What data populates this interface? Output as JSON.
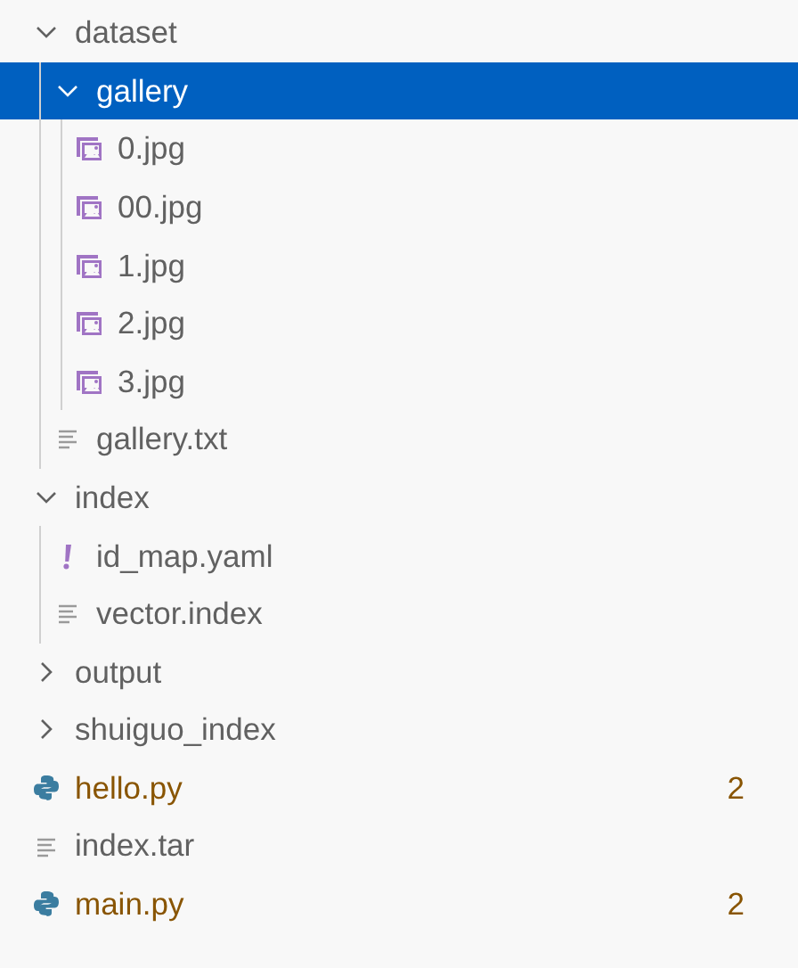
{
  "explorer": {
    "items": [
      {
        "name": "dataset",
        "kind": "folder",
        "expanded": true,
        "selected": false,
        "warning": false,
        "children": [
          {
            "name": "gallery",
            "kind": "folder",
            "expanded": true,
            "selected": true,
            "warning": false,
            "children": [
              {
                "name": "0.jpg",
                "kind": "image",
                "selected": false,
                "warning": false
              },
              {
                "name": "00.jpg",
                "kind": "image",
                "selected": false,
                "warning": false
              },
              {
                "name": "1.jpg",
                "kind": "image",
                "selected": false,
                "warning": false
              },
              {
                "name": "2.jpg",
                "kind": "image",
                "selected": false,
                "warning": false
              },
              {
                "name": "3.jpg",
                "kind": "image",
                "selected": false,
                "warning": false
              }
            ]
          },
          {
            "name": "gallery.txt",
            "kind": "text",
            "selected": false,
            "warning": false
          }
        ]
      },
      {
        "name": "index",
        "kind": "folder",
        "expanded": true,
        "selected": false,
        "warning": false,
        "children": [
          {
            "name": "id_map.yaml",
            "kind": "yaml",
            "selected": false,
            "warning": false
          },
          {
            "name": "vector.index",
            "kind": "text",
            "selected": false,
            "warning": false
          }
        ]
      },
      {
        "name": "output",
        "kind": "folder",
        "expanded": false,
        "selected": false,
        "warning": false
      },
      {
        "name": "shuiguo_index",
        "kind": "folder",
        "expanded": false,
        "selected": false,
        "warning": false
      },
      {
        "name": "hello.py",
        "kind": "python",
        "selected": false,
        "warning": true,
        "badge": "2"
      },
      {
        "name": "index.tar",
        "kind": "text",
        "selected": false,
        "warning": false
      },
      {
        "name": "main.py",
        "kind": "python",
        "selected": false,
        "warning": true,
        "badge": "2"
      }
    ]
  }
}
